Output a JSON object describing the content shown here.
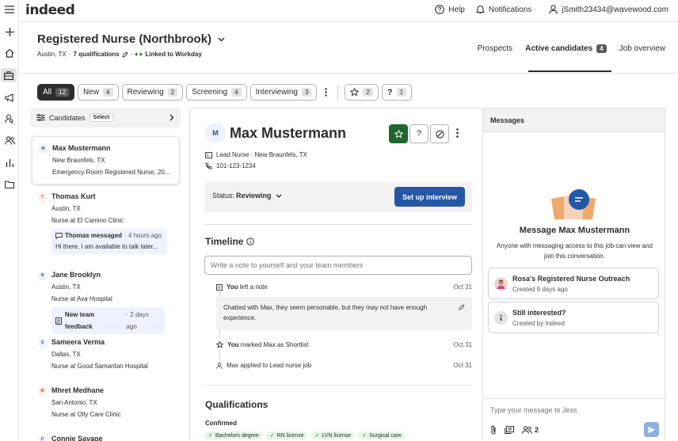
{
  "brand": "indeed",
  "topnav": {
    "help": "Help",
    "notifications": "Notifications",
    "email": "jSmith23434@wavewood.com"
  },
  "job": {
    "title": "Registered Nurse (Northbrook)",
    "location": "Austin, TX",
    "sep1": "·",
    "qualifications": "7 qualifications",
    "sep2": "·",
    "linked": "Linked to Workday"
  },
  "jobtabs": [
    {
      "label": "Prospects"
    },
    {
      "label": "Active candidates",
      "count": "4"
    },
    {
      "label": "Job overview"
    }
  ],
  "filters": [
    {
      "label": "All",
      "count": "12"
    },
    {
      "label": "New",
      "count": "4"
    },
    {
      "label": "Reviewing",
      "count": "2"
    },
    {
      "label": "Screening",
      "count": "4"
    },
    {
      "label": "Interviewing",
      "count": "3"
    }
  ],
  "rating_filters": [
    {
      "icon": "star-icon",
      "count": "2"
    },
    {
      "icon": "question-icon",
      "count": "1"
    }
  ],
  "list": {
    "header": "Candidates",
    "select": "Select"
  },
  "candidates": [
    {
      "initial": "M",
      "name": "Max Mustermann",
      "loc": "New Braunfels, TX",
      "job": "Emergency Room Registered Nurse, 20..."
    },
    {
      "initial": "T",
      "name": "Thomas Kurt",
      "loc": "Austin, TX",
      "job": "Nurse at El Camino Clinic",
      "msg_from": "Thomas messaged",
      "msg_time": "· 4 hours ago",
      "msg_text": "Hi there, I am available to talk later..."
    },
    {
      "initial": "N",
      "name": "Jane Brooklyn",
      "loc": "Austin, TX",
      "job": "Nurse at Ava Hospital",
      "feedback": "New team feedback",
      "feedback_time": "· 2 days ago"
    },
    {
      "initial": "S",
      "name": "Sameera Verma",
      "loc": "Dallas, TX",
      "job": "Nurse at Good Samaritan Hospital"
    },
    {
      "initial": "M",
      "name": "Mhret Medhane",
      "loc": "San Antonio, TX",
      "job": "Nurse at Olly Care Clinic"
    },
    {
      "initial": "C",
      "name": "Connie Savage"
    }
  ],
  "detail": {
    "initial": "M",
    "name": "Max Mustermann",
    "headline": "Lead Nurse · New Braunfels, TX",
    "phone": "101-123-1234",
    "status_label": "Status:",
    "status_value": "Reviewing",
    "setup_button": "Set up interview",
    "timeline_title": "Timeline",
    "note_placeholder": "Write a note to yourself and your team members",
    "timeline": [
      {
        "actor": "You",
        "text": "left a note",
        "date": "Oct 31"
      },
      {
        "actor": "You",
        "text": "marked Max as Shortlist",
        "date": "Oct 31"
      },
      {
        "actor": "",
        "text": "Max applied to Lead nurse job",
        "date": "Oct 31"
      }
    ],
    "note_text": "Chatted with Max, they seem personable, but they may not have enough experience.",
    "qualifications_title": "Qualifications",
    "confirmed_label": "Confirmed",
    "qual_tags": [
      "Bachelors degree",
      "RN license",
      "LVN license",
      "Surgical care"
    ]
  },
  "messages": {
    "header": "Messages",
    "title": "Message Max Mustermann",
    "description": "Anyone with messaging access to this job can view and join this conversation.",
    "templates": [
      {
        "title": "Rosa's Registered Nurse Outreach",
        "sub": "Created 9 days ago"
      },
      {
        "title": "Still interested?",
        "sub": "Created by Indeed"
      }
    ],
    "composer_placeholder": "Type your message to Jess",
    "people_count": "2"
  },
  "colors": {
    "primary": "#2557a7",
    "shortlist_green": "#1f662c",
    "text": "#2d2d2d",
    "chip_bg": "#eef1fe"
  }
}
